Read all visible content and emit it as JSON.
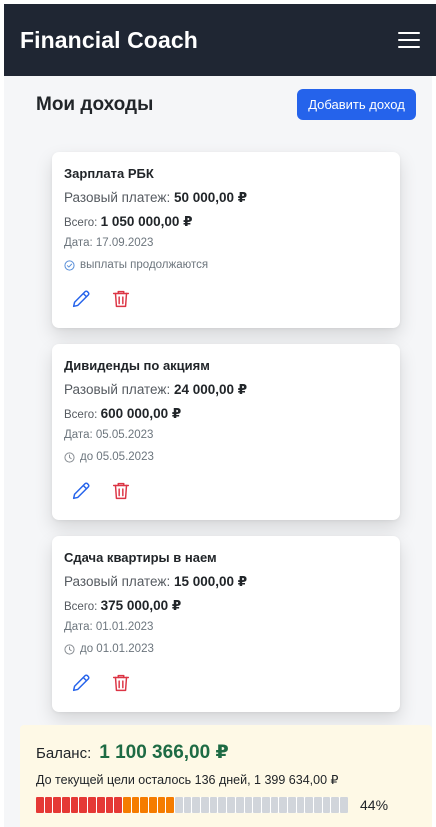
{
  "app": {
    "title": "Financial Coach"
  },
  "page": {
    "title": "Мои доходы",
    "add_button": "Добавить доход"
  },
  "incomes": [
    {
      "title": "Зарплата РБК",
      "payment_label": "Разовый платеж:",
      "payment_value": "50 000,00 ₽",
      "total_label": "Всего:",
      "total_value": "1 050 000,00 ₽",
      "date": "Дата: 17.09.2023",
      "status": "выплаты продолжаются",
      "status_icon": "check-circle-icon"
    },
    {
      "title": "Дивиденды по акциям",
      "payment_label": "Разовый платеж:",
      "payment_value": "24 000,00 ₽",
      "total_label": "Всего:",
      "total_value": "600 000,00 ₽",
      "date": "Дата: 05.05.2023",
      "status": "до 05.05.2023",
      "status_icon": "clock-icon"
    },
    {
      "title": "Сдача квартиры в наем",
      "payment_label": "Разовый платеж:",
      "payment_value": "15 000,00 ₽",
      "total_label": "Всего:",
      "total_value": "375 000,00 ₽",
      "date": "Дата: 01.01.2023",
      "status": "до 01.01.2023",
      "status_icon": "clock-icon"
    }
  ],
  "balance": {
    "label": "Баланс:",
    "value": "1 100 366,00 ₽",
    "goal_text": "До текущей цели осталось 136 дней, 1 399 634,00 ₽",
    "progress_percent": 44,
    "progress_label": "44%"
  },
  "colors": {
    "navbar": "#1f2633",
    "accent": "#2563eb",
    "edit_icon": "#2563eb",
    "delete_icon": "#dc3545",
    "balance_value": "#1e6b44",
    "progress_red": "#e53935",
    "progress_orange": "#f57c00",
    "progress_empty": "#d1d5db"
  }
}
